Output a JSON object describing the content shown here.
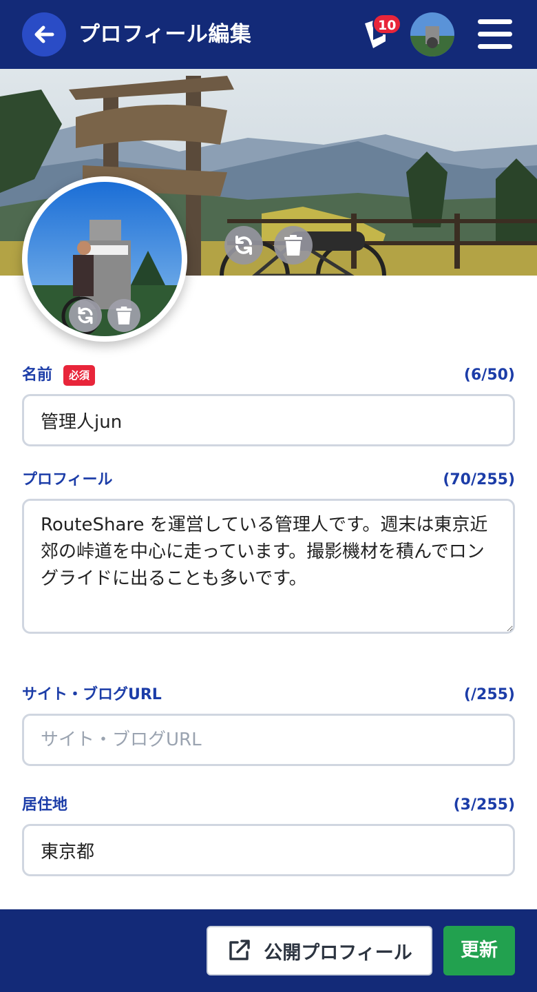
{
  "header": {
    "title": "プロフィール編集",
    "notification_count": "10",
    "colors": {
      "background": "#132a78",
      "badge": "#e8253a"
    }
  },
  "icons": {
    "back": "arrow-left-icon",
    "notification": "notification-icon",
    "menu": "hamburger-menu-icon",
    "refresh": "refresh-icon",
    "trash": "trash-icon",
    "external": "external-link-icon"
  },
  "form": {
    "name": {
      "label": "名前",
      "required_badge": "必須",
      "count": "(6/50)",
      "value": "管理人jun"
    },
    "profile": {
      "label": "プロフィール",
      "count": "(70/255)",
      "value": "RouteShare を運営している管理人です。週末は東京近郊の峠道を中心に走っています。撮影機材を積んでロングライドに出ることも多いです。"
    },
    "site": {
      "label": "サイト・ブログURL",
      "count": "(/255)",
      "value": "",
      "placeholder": "サイト・ブログURL"
    },
    "residence": {
      "label": "居住地",
      "count": "(3/255)",
      "value": "東京都"
    }
  },
  "footer": {
    "public_profile_label": "公開プロフィール",
    "update_label": "更新",
    "colors": {
      "update": "#22a14f"
    }
  }
}
